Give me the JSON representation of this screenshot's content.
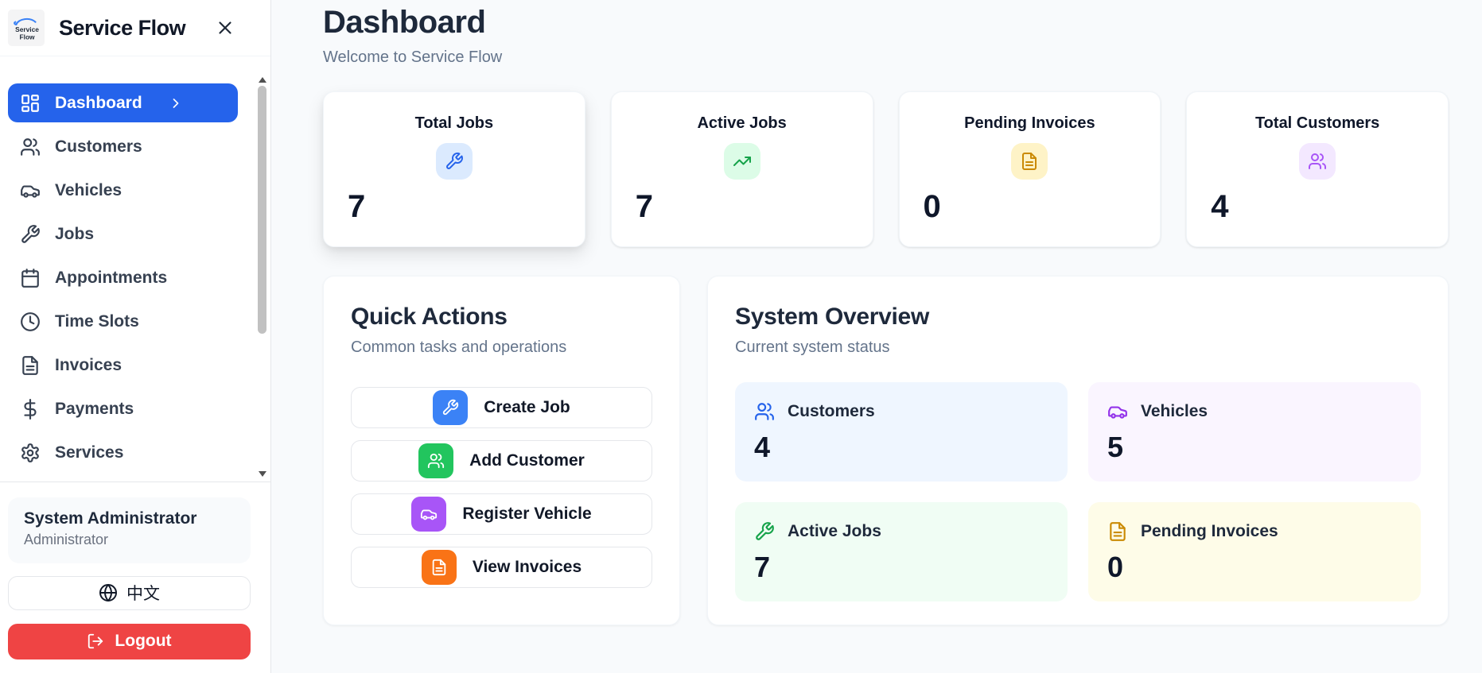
{
  "app": {
    "title": "Service Flow",
    "logo_line1": "Service",
    "logo_line2": "Flow"
  },
  "sidebar": {
    "items": [
      {
        "label": "Dashboard",
        "icon": "layout-dashboard-icon",
        "active": true
      },
      {
        "label": "Customers",
        "icon": "users-icon"
      },
      {
        "label": "Vehicles",
        "icon": "car-icon"
      },
      {
        "label": "Jobs",
        "icon": "wrench-icon"
      },
      {
        "label": "Appointments",
        "icon": "calendar-icon"
      },
      {
        "label": "Time Slots",
        "icon": "clock-icon"
      },
      {
        "label": "Invoices",
        "icon": "file-text-icon"
      },
      {
        "label": "Payments",
        "icon": "dollar-icon"
      },
      {
        "label": "Services",
        "icon": "gear-icon"
      }
    ],
    "active_color": "#2563eb",
    "user": {
      "name": "System Administrator",
      "role": "Administrator"
    },
    "language_button": {
      "label": "中文",
      "icon": "globe-icon"
    },
    "logout_button": {
      "label": "Logout",
      "icon": "logout-icon",
      "color": "#ef4444"
    }
  },
  "header": {
    "title": "Dashboard",
    "subtitle": "Welcome to Service Flow"
  },
  "stats": [
    {
      "label": "Total Jobs",
      "value": "7",
      "icon": "wrench-icon",
      "icon_color": "#2563eb",
      "icon_bg": "#dbeafe"
    },
    {
      "label": "Active Jobs",
      "value": "7",
      "icon": "trending-up-icon",
      "icon_color": "#16a34a",
      "icon_bg": "#dcfce7"
    },
    {
      "label": "Pending Invoices",
      "value": "0",
      "icon": "file-text-icon",
      "icon_color": "#ca8a04",
      "icon_bg": "#fef3c7"
    },
    {
      "label": "Total Customers",
      "value": "4",
      "icon": "users-icon",
      "icon_color": "#a855f7",
      "icon_bg": "#f3e8ff"
    }
  ],
  "quick_actions": {
    "title": "Quick Actions",
    "subtitle": "Common tasks and operations",
    "buttons": [
      {
        "label": "Create Job",
        "icon": "wrench-icon",
        "color": "#3b82f6"
      },
      {
        "label": "Add Customer",
        "icon": "users-icon",
        "color": "#22c55e"
      },
      {
        "label": "Register Vehicle",
        "icon": "car-icon",
        "color": "#a855f7"
      },
      {
        "label": "View Invoices",
        "icon": "file-text-icon",
        "color": "#f97316"
      }
    ]
  },
  "system_overview": {
    "title": "System Overview",
    "subtitle": "Current system status",
    "tiles": [
      {
        "label": "Customers",
        "value": "4",
        "icon": "users-icon",
        "bg": "#eff6ff",
        "icon_color": "#2563eb"
      },
      {
        "label": "Vehicles",
        "value": "5",
        "icon": "car-icon",
        "bg": "#faf5ff",
        "icon_color": "#9333ea"
      },
      {
        "label": "Active Jobs",
        "value": "7",
        "icon": "wrench-icon",
        "bg": "#f0fdf4",
        "icon_color": "#16a34a"
      },
      {
        "label": "Pending Invoices",
        "value": "0",
        "icon": "file-text-icon",
        "bg": "#fefce8",
        "icon_color": "#ca8a04"
      }
    ]
  }
}
